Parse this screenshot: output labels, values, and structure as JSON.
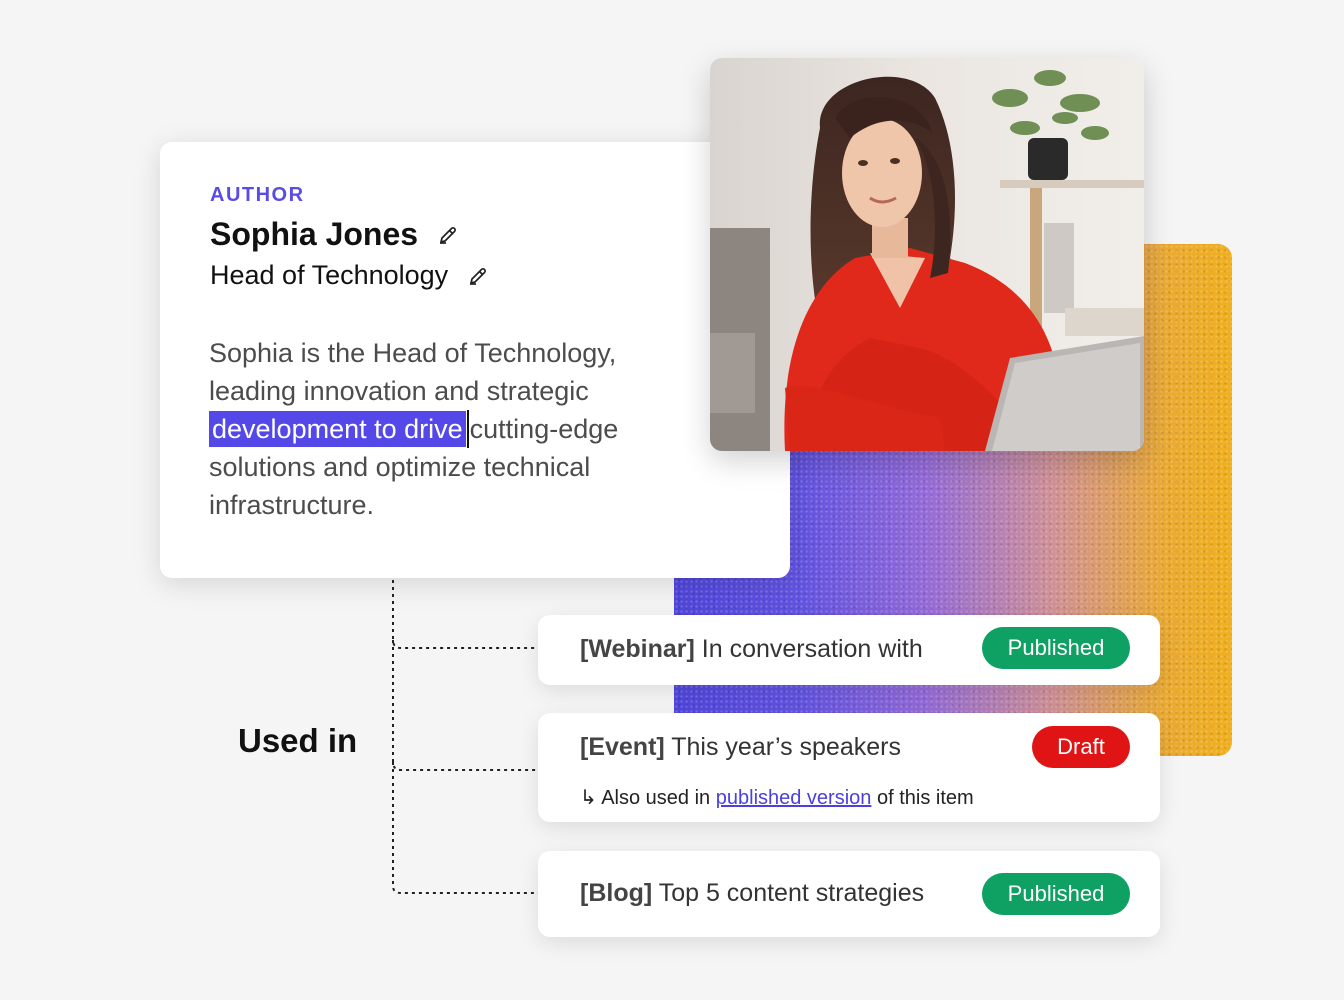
{
  "author": {
    "section_label": "AUTHOR",
    "name": "Sophia Jones",
    "role": "Head of Technology",
    "bio_before": "Sophia is the Head of Technology, leading innovation and strategic ",
    "bio_selected": "development to drive",
    "bio_after": "cutting-edge solutions and optimize technical infrastructure.",
    "edit_icon": "pencil-edit-icon"
  },
  "used_in_label": "Used in",
  "usages": [
    {
      "type": "[Webinar]",
      "title": "In conversation with",
      "status": "Published",
      "status_color": "#0fa063"
    },
    {
      "type": "[Event]",
      "title": "This year’s speakers",
      "status": "Draft",
      "status_color": "#e01414",
      "note_arrow": "↳",
      "note_before": "Also used in",
      "note_link": "published version",
      "note_after": "of this item"
    },
    {
      "type": "[Blog]",
      "title": "Top 5 content strategies",
      "status": "Published",
      "status_color": "#0fa063"
    }
  ],
  "colors": {
    "accent": "#5a4be6",
    "published": "#0fa063",
    "draft": "#e01414"
  }
}
